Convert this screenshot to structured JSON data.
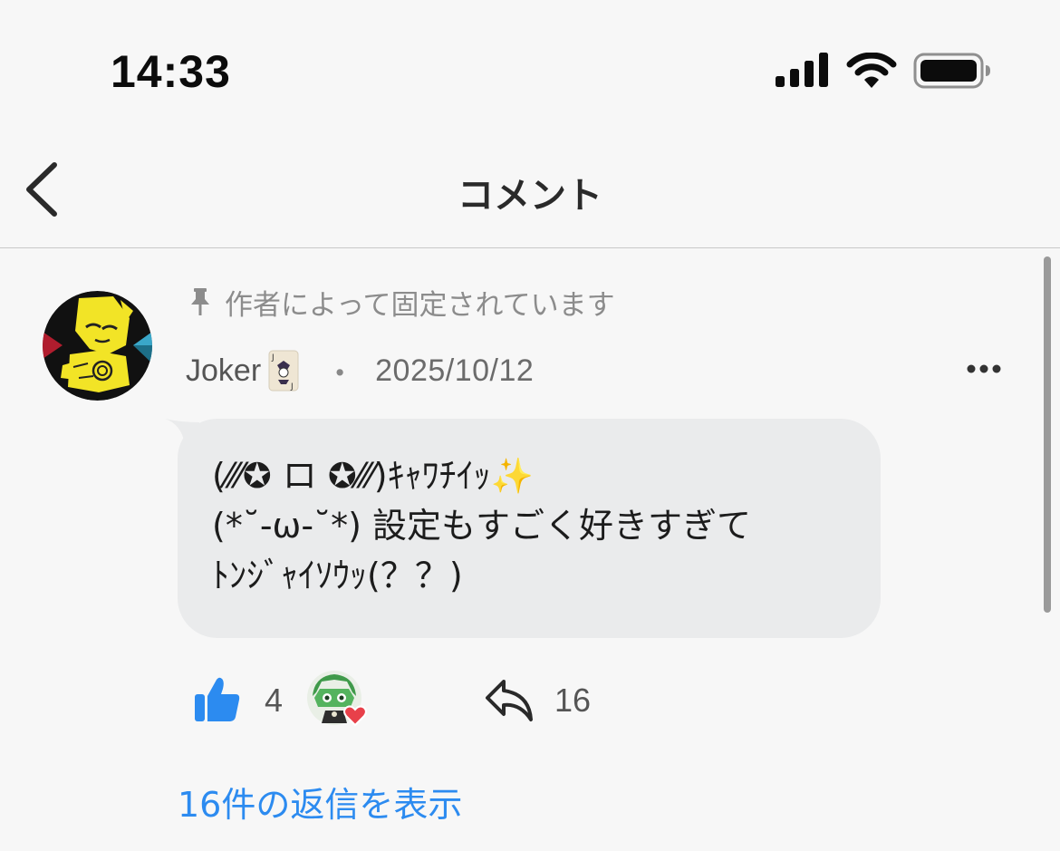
{
  "status_bar": {
    "time": "14:33",
    "icons": [
      "signal-icon",
      "wifi-icon",
      "battery-icon"
    ]
  },
  "nav": {
    "title": "コメント",
    "back_icon": "chevron-left-icon"
  },
  "comment": {
    "pinned_label": "作者によって固定されています",
    "author": "Joker",
    "author_badge_icon": "joker-playing-card-icon",
    "separator": "・",
    "date": "2025/10/12",
    "more_icon": "more-horizontal-icon",
    "body_lines": [
      "(⁄⁄⁄✪ ロ ✪⁄⁄⁄)ｷｬﾜﾁｲｯ✨",
      "(*˘-ω-˘*) 設定もすごく好きすぎて",
      "ﾄﾝｼﾞｬｲｿｳｯ(？？)"
    ],
    "likes": "4",
    "reaction_icon": "heart-icon",
    "shares": "16",
    "view_replies": "16件の返信を表示"
  },
  "colors": {
    "background": "#f7f7f7",
    "bubble": "#eaebec",
    "accent_blue": "#2c8bf0",
    "muted_text": "#8c8c8c",
    "heart": "#e8404a"
  }
}
